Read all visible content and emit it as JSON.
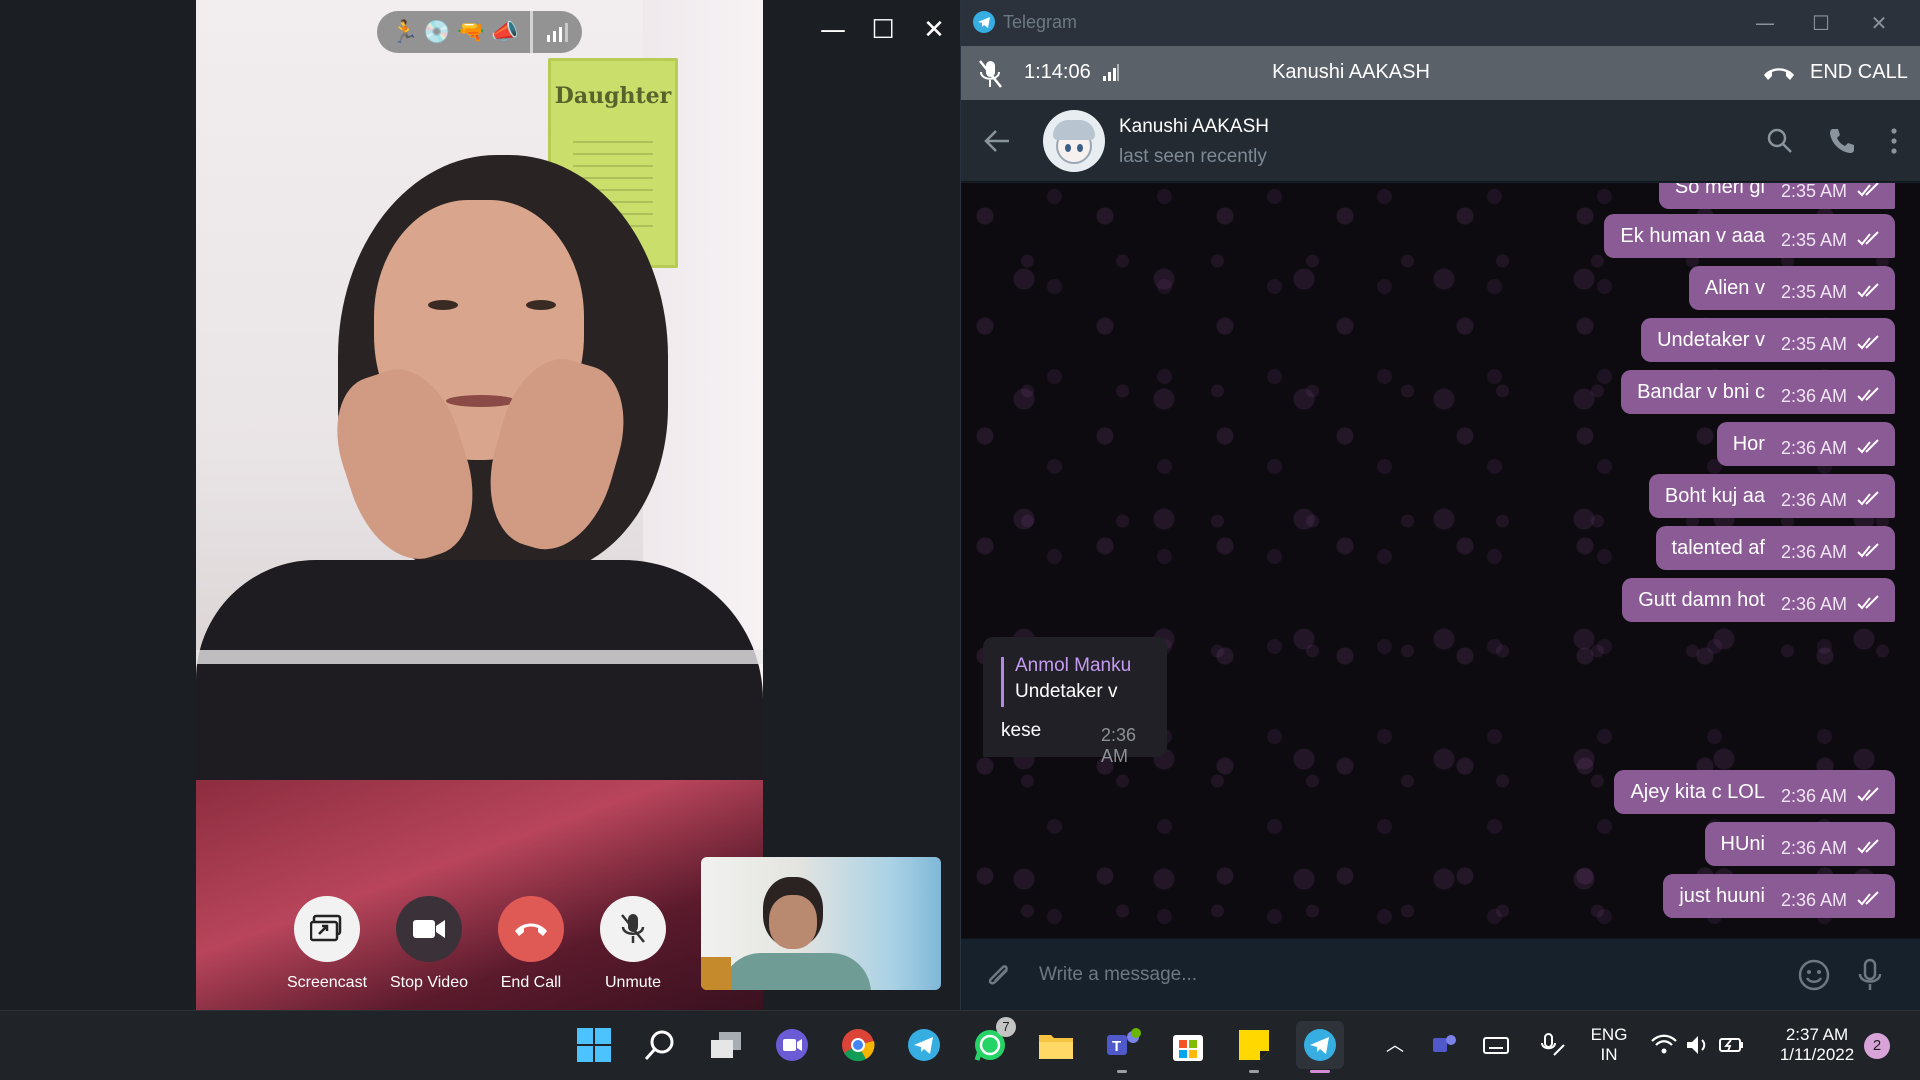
{
  "call_window": {
    "status_icons": [
      "runner-emoji",
      "disc-emoji",
      "water-gun-emoji",
      "megaphone-emoji"
    ],
    "buttons": [
      {
        "label": "Screencast",
        "icon": "screencast-icon"
      },
      {
        "label": "Stop Video",
        "icon": "video-camera-icon"
      },
      {
        "label": "End Call",
        "icon": "hang-up-icon"
      },
      {
        "label": "Unmute",
        "icon": "mic-muted-icon"
      }
    ],
    "poster_text": "Daughter",
    "win_controls": {
      "minimize": "—",
      "maximize": "☐",
      "close": "✕"
    }
  },
  "telegram": {
    "title": "Telegram",
    "call_bar": {
      "duration": "1:14:06",
      "contact": "Kanushi AAKASH",
      "end_label": "END CALL"
    },
    "header": {
      "name": "Kanushi AAKASH",
      "status": "last seen recently"
    },
    "messages_out": [
      {
        "text": "So  meri gi",
        "time": "2:35 AM"
      },
      {
        "text": "Ek human v aaa",
        "time": "2:35 AM"
      },
      {
        "text": "Alien v",
        "time": "2:35 AM"
      },
      {
        "text": "Undetaker v",
        "time": "2:35 AM"
      },
      {
        "text": "Bandar v bni c",
        "time": "2:36 AM"
      },
      {
        "text": "Hor",
        "time": "2:36 AM"
      },
      {
        "text": "Boht kuj aa",
        "time": "2:36 AM"
      },
      {
        "text": "talented af",
        "time": "2:36 AM"
      },
      {
        "text": "Gutt damn hot",
        "time": "2:36 AM"
      }
    ],
    "message_in": {
      "reply_author": "Anmol Manku",
      "reply_text": "Undetaker v",
      "text": "kese",
      "time": "2:36 AM"
    },
    "messages_out_after": [
      {
        "text": "Ajey kita c LOL",
        "time": "2:36 AM"
      },
      {
        "text": "HUni",
        "time": "2:36 AM"
      },
      {
        "text": "just huuni",
        "time": "2:36 AM"
      }
    ],
    "composer": {
      "placeholder": "Write a message..."
    }
  },
  "taskbar": {
    "whatsapp_badge": "7",
    "language_line1": "ENG",
    "language_line2": "IN",
    "time": "2:37 AM",
    "date": "1/11/2022",
    "notification_count": "2"
  },
  "colors": {
    "outgoing_bubble": "#8b5b96",
    "incoming_bubble": "#222027",
    "end_call_red": "#e05a55",
    "accent": "#37aee2"
  }
}
